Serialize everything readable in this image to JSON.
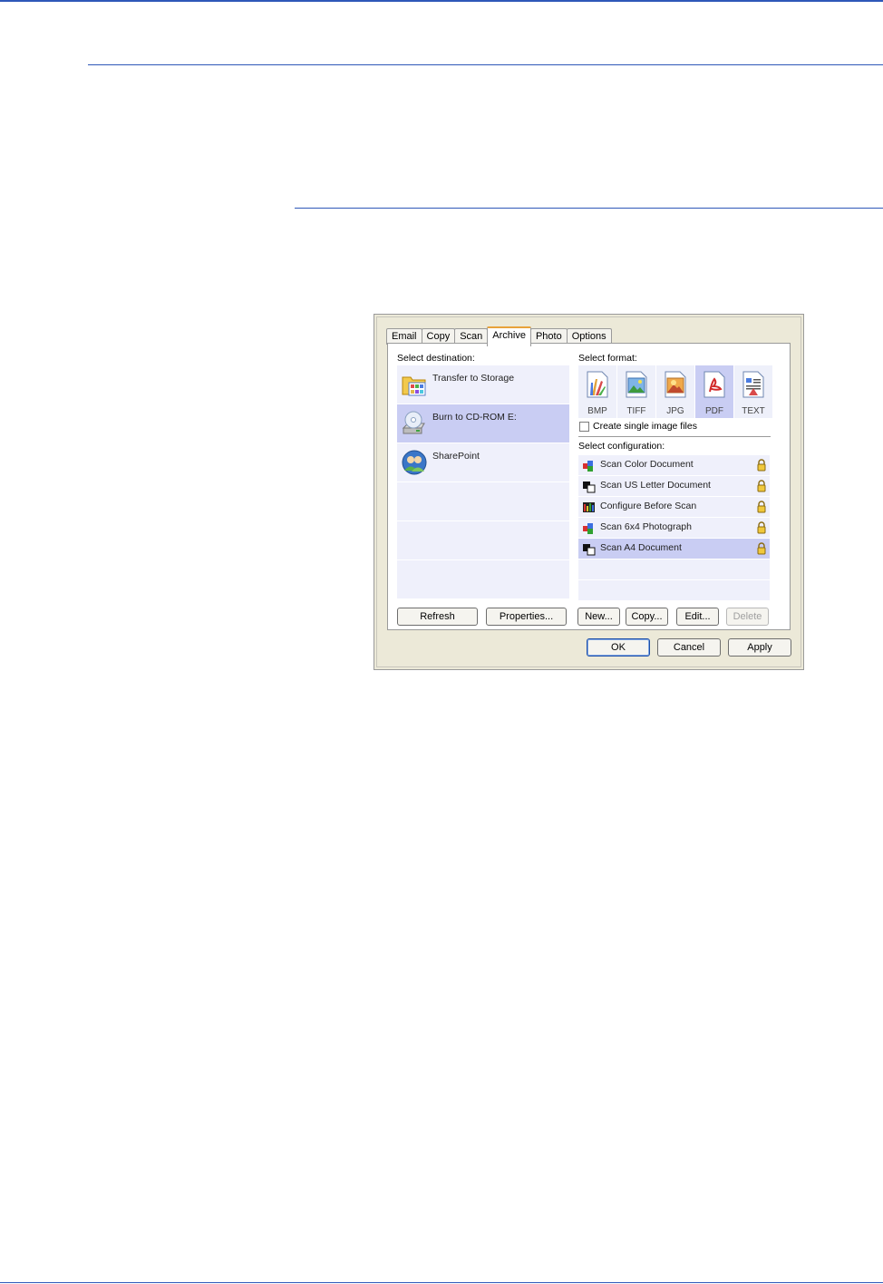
{
  "tabs": [
    {
      "label": "Email"
    },
    {
      "label": "Copy"
    },
    {
      "label": "Scan"
    },
    {
      "label": "Archive"
    },
    {
      "label": "Photo"
    },
    {
      "label": "Options"
    }
  ],
  "active_tab": "Archive",
  "destination": {
    "heading": "Select destination:",
    "items": [
      {
        "label": "Transfer to Storage",
        "icon": "folder-icon"
      },
      {
        "label": "Burn to CD-ROM  E:",
        "icon": "cd-drive-icon"
      },
      {
        "label": "SharePoint",
        "icon": "sharepoint-icon"
      }
    ],
    "selected": "Burn to CD-ROM  E:"
  },
  "format": {
    "heading": "Select format:",
    "items": [
      {
        "label": "BMP",
        "icon": "bmp-icon"
      },
      {
        "label": "TIFF",
        "icon": "tiff-icon"
      },
      {
        "label": "JPG",
        "icon": "jpg-icon"
      },
      {
        "label": "PDF",
        "icon": "pdf-icon"
      },
      {
        "label": "TEXT",
        "icon": "text-icon"
      }
    ],
    "selected": "PDF",
    "single_image_label": "Create single image files"
  },
  "configuration": {
    "heading": "Select configuration:",
    "items": [
      {
        "label": "Scan Color Document",
        "icon": "color-document-icon"
      },
      {
        "label": "Scan US Letter Document",
        "icon": "bw-document-icon"
      },
      {
        "label": "Configure Before Scan",
        "icon": "configure-icon"
      },
      {
        "label": "Scan 6x4 Photograph",
        "icon": "color-document-icon"
      },
      {
        "label": "Scan A4 Document",
        "icon": "bw-document-icon"
      }
    ],
    "selected": "Scan A4 Document"
  },
  "buttons": {
    "refresh": "Refresh",
    "properties": "Properties...",
    "new": "New...",
    "copy": "Copy...",
    "edit": "Edit...",
    "delete": "Delete",
    "ok": "OK",
    "cancel": "Cancel",
    "apply": "Apply"
  }
}
